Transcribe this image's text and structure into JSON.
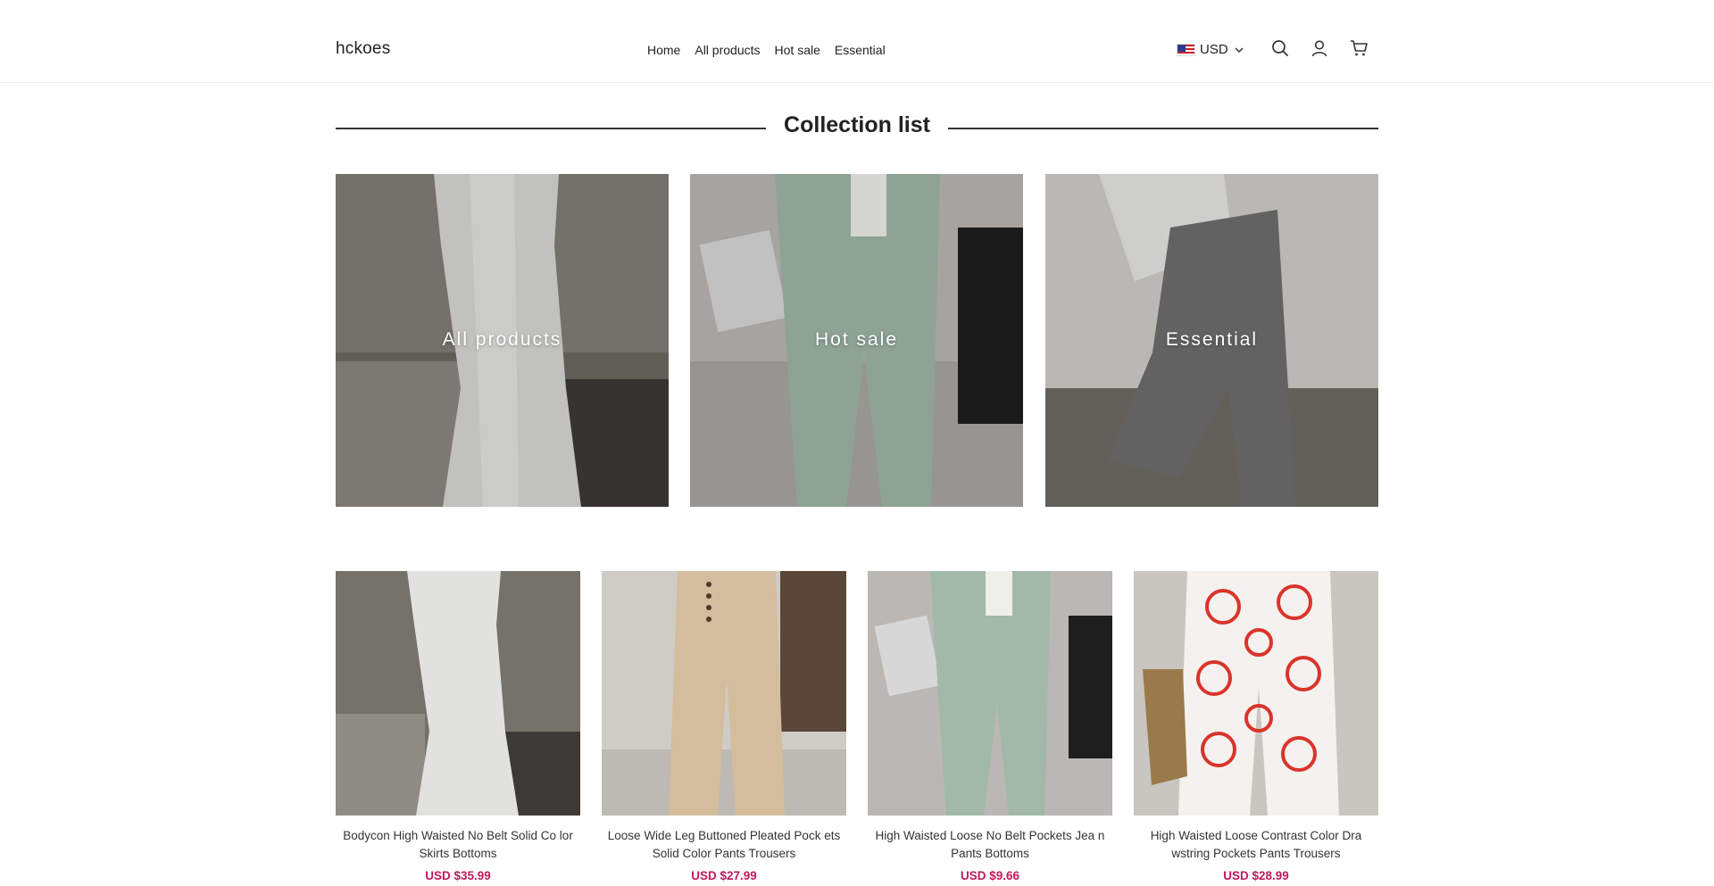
{
  "header": {
    "logo": "hckoes",
    "nav": [
      "Home",
      "All products",
      "Hot sale",
      "Essential"
    ],
    "currency": "USD",
    "icons": [
      "search-icon",
      "account-icon",
      "cart-icon"
    ]
  },
  "collection": {
    "title": "Collection list",
    "tiles": [
      {
        "label": "All products"
      },
      {
        "label": "Hot sale"
      },
      {
        "label": "Essential"
      }
    ]
  },
  "products": [
    {
      "title": "Bodycon High Waisted No Belt Solid Co lor Skirts Bottoms",
      "price": "USD $35.99"
    },
    {
      "title": "Loose Wide Leg Buttoned Pleated Pock ets Solid Color Pants Trousers",
      "price": "USD $27.99"
    },
    {
      "title": "High Waisted Loose No Belt Pockets Jea n Pants Bottoms",
      "price": "USD $9.66"
    },
    {
      "title": "High Waisted Loose Contrast Color Dra wstring Pockets Pants Trousers",
      "price": "USD $28.99"
    }
  ],
  "colors": {
    "price": "#c2185b",
    "text": "#222222",
    "divider": "#333333"
  }
}
